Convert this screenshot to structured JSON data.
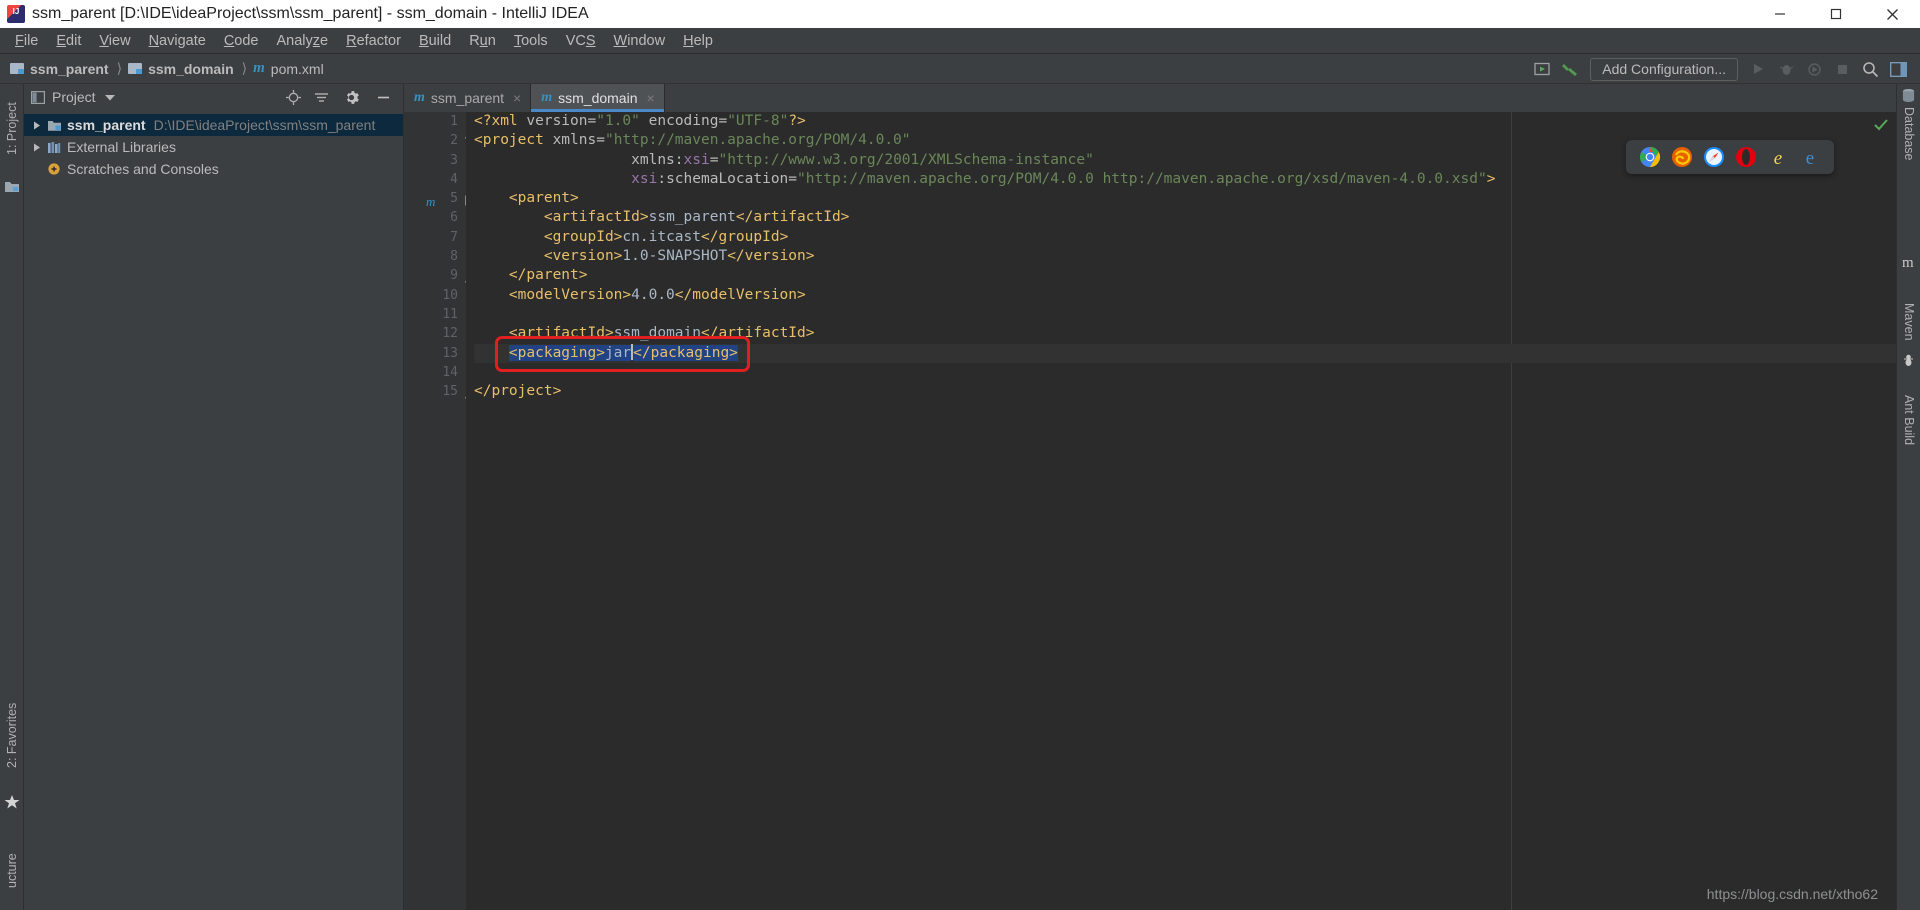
{
  "window": {
    "title": "ssm_parent [D:\\IDE\\ideaProject\\ssm\\ssm_parent] - ssm_domain - IntelliJ IDEA",
    "app_icon": "intellij-idea-icon",
    "minimize_label": "Minimize",
    "maximize_label": "Maximize",
    "close_label": "Close"
  },
  "menubar": {
    "items": [
      {
        "label": "File",
        "mnemonic": "F"
      },
      {
        "label": "Edit",
        "mnemonic": "E"
      },
      {
        "label": "View",
        "mnemonic": "V"
      },
      {
        "label": "Navigate",
        "mnemonic": "N"
      },
      {
        "label": "Code",
        "mnemonic": "C"
      },
      {
        "label": "Analyze",
        "mnemonic": "z"
      },
      {
        "label": "Refactor",
        "mnemonic": "R"
      },
      {
        "label": "Build",
        "mnemonic": "B"
      },
      {
        "label": "Run",
        "mnemonic": "u"
      },
      {
        "label": "Tools",
        "mnemonic": "T"
      },
      {
        "label": "VCS",
        "mnemonic": "S"
      },
      {
        "label": "Window",
        "mnemonic": "W"
      },
      {
        "label": "Help",
        "mnemonic": "H"
      }
    ]
  },
  "navbar": {
    "breadcrumbs": [
      {
        "label": "ssm_parent",
        "icon": "folder-icon"
      },
      {
        "label": "ssm_domain",
        "icon": "folder-icon"
      },
      {
        "label": "pom.xml",
        "icon": "maven-m-icon"
      }
    ],
    "separator": "〉",
    "add_configuration_label": "Add Configuration...",
    "right_icons": [
      "preview-icon",
      "hammer-build-icon",
      "run-icon",
      "debug-icon",
      "run-coverage-icon",
      "stop-icon",
      "search-everywhere-icon",
      "layout-icon"
    ]
  },
  "left_strip": {
    "project_label": "1: Project",
    "favorites_label": "2: Favorites",
    "structure_label": "ucture",
    "structure_full": "Structure"
  },
  "project_pane": {
    "title": "Project",
    "dropdown_icon": "chevron-down-icon",
    "header_icons": [
      "locate-icon",
      "collapse-all-icon",
      "settings-gear-icon",
      "hide-icon"
    ],
    "tree": [
      {
        "label": "ssm_parent",
        "sublabel": "D:\\IDE\\ideaProject\\ssm\\ssm_parent",
        "icon": "module-icon",
        "expanded": false,
        "selected": true,
        "has_twisty": true
      },
      {
        "label": "External Libraries",
        "sublabel": "",
        "icon": "libraries-icon",
        "expanded": false,
        "selected": false,
        "has_twisty": true
      },
      {
        "label": "Scratches and Consoles",
        "sublabel": "",
        "icon": "scratches-icon",
        "expanded": false,
        "selected": false,
        "has_twisty": false
      }
    ]
  },
  "editor": {
    "tabs": [
      {
        "label": "ssm_parent",
        "icon": "maven-m-icon",
        "active": false,
        "close": "×"
      },
      {
        "label": "ssm_domain",
        "icon": "maven-m-icon",
        "active": true,
        "close": "×"
      }
    ],
    "filename": "pom.xml",
    "inspection_status": "ok-checkmark-icon",
    "selection_text": "<packaging>jar</packaging>",
    "annotation": {
      "shape": "red-rounded-rectangle",
      "color": "#e02020"
    },
    "lines": [
      {
        "n": 1,
        "indent": 0,
        "fold": "",
        "tokens": [
          {
            "t": "<?xml ",
            "c": "tag"
          },
          {
            "t": "version=",
            "c": "attr"
          },
          {
            "t": "\"1.0\"",
            "c": "str"
          },
          {
            "t": " ",
            "c": "txt"
          },
          {
            "t": "encoding=",
            "c": "attr"
          },
          {
            "t": "\"UTF-8\"",
            "c": "str"
          },
          {
            "t": "?>",
            "c": "tag"
          }
        ]
      },
      {
        "n": 2,
        "indent": 0,
        "fold": "open",
        "tokens": [
          {
            "t": "<project ",
            "c": "tag"
          },
          {
            "t": "xmlns=",
            "c": "attr"
          },
          {
            "t": "\"http://maven.apache.org/POM/4.0.0\"",
            "c": "str"
          }
        ]
      },
      {
        "n": 3,
        "indent": 9,
        "fold": "",
        "tokens": [
          {
            "t": "xmlns:",
            "c": "attr"
          },
          {
            "t": "xsi",
            "c": "attrx"
          },
          {
            "t": "=",
            "c": "attr"
          },
          {
            "t": "\"http://www.w3.org/2001/XMLSchema-instance\"",
            "c": "str"
          }
        ]
      },
      {
        "n": 4,
        "indent": 9,
        "fold": "",
        "tokens": [
          {
            "t": "xsi",
            "c": "attrx"
          },
          {
            "t": ":schemaLocation=",
            "c": "attr"
          },
          {
            "t": "\"http://maven.apache.org/POM/4.0.0 http://maven.apache.org/xsd/maven-4.0.0.xsd\"",
            "c": "str"
          },
          {
            "t": ">",
            "c": "tag"
          }
        ]
      },
      {
        "n": 5,
        "indent": 2,
        "fold": "minus",
        "gutter_icon": "maven-m-icon",
        "tokens": [
          {
            "t": "<parent>",
            "c": "tag"
          }
        ]
      },
      {
        "n": 6,
        "indent": 4,
        "fold": "",
        "tokens": [
          {
            "t": "<artifactId>",
            "c": "tag"
          },
          {
            "t": "ssm_parent",
            "c": "txt"
          },
          {
            "t": "</artifactId>",
            "c": "tag"
          }
        ]
      },
      {
        "n": 7,
        "indent": 4,
        "fold": "",
        "tokens": [
          {
            "t": "<groupId>",
            "c": "tag"
          },
          {
            "t": "cn.itcast",
            "c": "txt"
          },
          {
            "t": "</groupId>",
            "c": "tag"
          }
        ]
      },
      {
        "n": 8,
        "indent": 4,
        "fold": "",
        "tokens": [
          {
            "t": "<version>",
            "c": "tag"
          },
          {
            "t": "1.0-SNAPSHOT",
            "c": "txt"
          },
          {
            "t": "</version>",
            "c": "tag"
          }
        ]
      },
      {
        "n": 9,
        "indent": 2,
        "fold": "end",
        "tokens": [
          {
            "t": "</parent>",
            "c": "tag"
          }
        ]
      },
      {
        "n": 10,
        "indent": 2,
        "fold": "",
        "tokens": [
          {
            "t": "<modelVersion>",
            "c": "tag"
          },
          {
            "t": "4.0.0",
            "c": "txt"
          },
          {
            "t": "</modelVersion>",
            "c": "tag"
          }
        ]
      },
      {
        "n": 11,
        "indent": 0,
        "fold": "",
        "tokens": []
      },
      {
        "n": 12,
        "indent": 2,
        "fold": "",
        "tokens": [
          {
            "t": "<artifactId>",
            "c": "tag"
          },
          {
            "t": "ssm_domain",
            "c": "txt"
          },
          {
            "t": "</artifactId>",
            "c": "tag"
          }
        ]
      },
      {
        "n": 13,
        "indent": 2,
        "fold": "",
        "highlight": true,
        "tokens": [
          {
            "t": "<packaging>",
            "c": "tag",
            "sel": true
          },
          {
            "t": "jar",
            "c": "txt",
            "sel": true
          },
          {
            "t": "|",
            "c": "caret"
          },
          {
            "t": "</packaging>",
            "c": "tag",
            "sel": true
          }
        ]
      },
      {
        "n": 14,
        "indent": 0,
        "fold": "",
        "tokens": []
      },
      {
        "n": 15,
        "indent": 0,
        "fold": "end",
        "tokens": [
          {
            "t": "</project>",
            "c": "tag"
          }
        ]
      }
    ]
  },
  "browser_bar": {
    "icons": [
      {
        "name": "chrome-icon",
        "title": "Chrome"
      },
      {
        "name": "firefox-icon",
        "title": "Firefox"
      },
      {
        "name": "safari-icon",
        "title": "Safari"
      },
      {
        "name": "opera-icon",
        "title": "Opera"
      },
      {
        "name": "internet-explorer-icon",
        "title": "Internet Explorer"
      },
      {
        "name": "edge-icon",
        "title": "Edge"
      }
    ]
  },
  "right_strip": {
    "database_label": "Database",
    "maven_label": "m Maven",
    "maven_text": "Maven",
    "ant_label": "Ant Build"
  },
  "watermark": {
    "text": "https://blog.csdn.net/xtho62"
  },
  "colors": {
    "accent_blue": "#4a88c7",
    "annotation_red": "#e02020",
    "selection_blue": "#214283",
    "editor_bg": "#2b2b2b",
    "chrome_bg": "#3c3f41",
    "tag_color": "#e8bf6a",
    "string_color": "#6a8759"
  }
}
